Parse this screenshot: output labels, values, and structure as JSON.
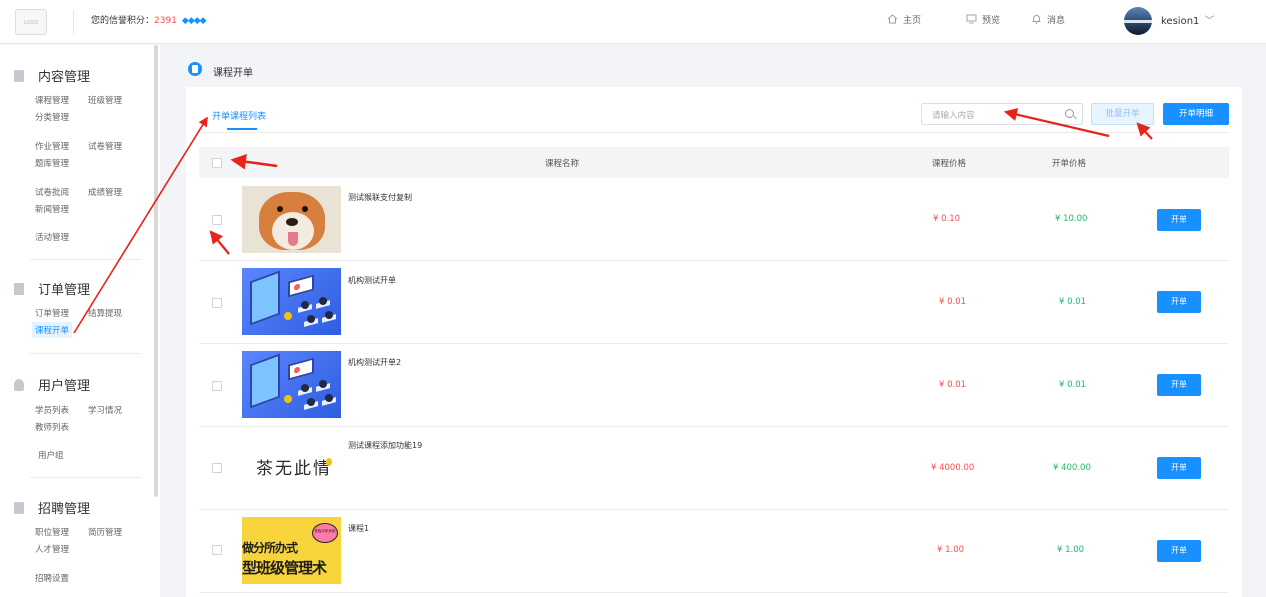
{
  "header": {
    "logo_text": "LOGO",
    "credit_label": "您的信誉积分：",
    "credit_score": "2391",
    "credit_gems": "◆◆◆◆",
    "nav": [
      {
        "label": "主页",
        "icon": "home-icon"
      },
      {
        "label": "预览",
        "icon": "monitor-icon"
      },
      {
        "label": "消息",
        "icon": "bell-icon"
      }
    ],
    "username": "kesion1",
    "username_caret": "﹀"
  },
  "sidebar": {
    "sections": [
      {
        "title": "内容管理",
        "links": [
          "课程管理",
          "班级管理",
          "分类管理",
          "作业管理",
          "试卷管理",
          "题库管理",
          "试卷批阅",
          "成绩管理",
          "新闻管理",
          "活动管理"
        ]
      },
      {
        "title": "订单管理",
        "links": [
          "订单管理",
          "结算提现",
          "课程开单"
        ]
      },
      {
        "title": "用户管理",
        "links": [
          "学员列表",
          "学习情况",
          "教师列表",
          "用户组"
        ]
      },
      {
        "title": "招聘管理",
        "links": [
          "职位管理",
          "简历管理",
          "人才管理",
          "招聘设置"
        ]
      }
    ],
    "active_link": "课程开单"
  },
  "breadcrumb": {
    "title": "课程开单"
  },
  "toolbar": {
    "tab_label": "开单课程列表",
    "search_placeholder": "请输入内容",
    "batch_label": "批量开单",
    "detail_label": "开单明细"
  },
  "table": {
    "columns": [
      "课程名称",
      "课程价格",
      "开单价格"
    ],
    "rows": [
      {
        "name": "测试猴联支付复制",
        "price": "¥ 0.10",
        "open_price": "¥ 10.00",
        "action": "开单",
        "thumb": "dog"
      },
      {
        "name": "机构测试开单",
        "price": "¥ 0.01",
        "open_price": "¥ 0.01",
        "action": "开单",
        "thumb": "iso"
      },
      {
        "name": "机构测试开单2",
        "price": "¥ 0.01",
        "open_price": "¥ 0.01",
        "action": "开单",
        "thumb": "iso"
      },
      {
        "name": "测试课程添加功能19",
        "price": "¥ 4000.00",
        "open_price": "¥ 400.00",
        "action": "开单",
        "thumb": "tea",
        "thumb_text": "茶无此情"
      },
      {
        "name": "课程1",
        "price": "¥ 1.00",
        "open_price": "¥ 1.00",
        "action": "开单",
        "thumb": "yellow",
        "thumb_lines": [
          "做分所办式",
          "型班级管理术"
        ],
        "thumb_bubble": "老板手机系统"
      }
    ]
  },
  "colors": {
    "primary": "#1890ff",
    "price_red": "#ff4d4f",
    "price_green": "#19be6b",
    "annotation": "#e8231a"
  }
}
